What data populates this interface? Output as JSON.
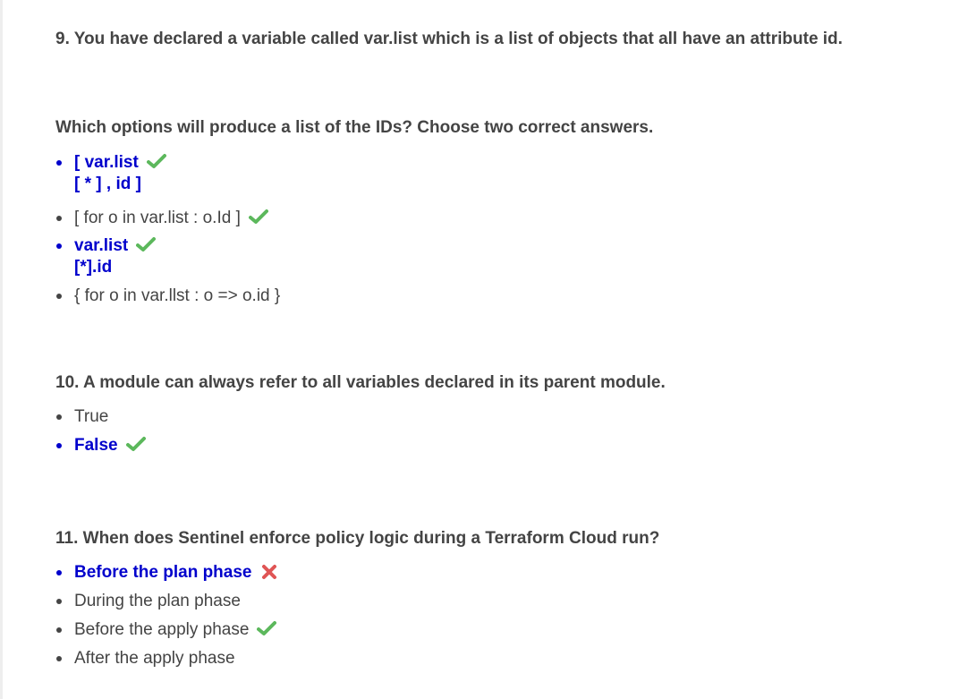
{
  "questions": [
    {
      "title": "9. You have declared a variable called var.list which is a list of objects that all have an attribute id.",
      "subtitle": "Which options will produce a list of the IDs? Choose two correct answers.",
      "options": [
        {
          "line1": "[ var.list",
          "line2": "[ * ] , id ]",
          "selected": true,
          "mark": "check-icon"
        },
        {
          "line1": "[ for o in var.list : o.Id ]",
          "selected": false,
          "mark": "check-icon"
        },
        {
          "line1": "var.list",
          "line2": "[*].id",
          "selected": true,
          "mark": "check-icon"
        },
        {
          "line1": "{ for o in var.llst : o => o.id }",
          "selected": false,
          "mark": "none"
        }
      ]
    },
    {
      "title": "10. A module can always refer to all variables declared in its parent module.",
      "options": [
        {
          "line1": "True",
          "selected": false,
          "mark": "none"
        },
        {
          "line1": "False",
          "selected": true,
          "mark": "check-icon"
        }
      ]
    },
    {
      "title": "11. When does Sentinel enforce policy logic during a Terraform Cloud run?",
      "options": [
        {
          "line1": "Before the plan phase",
          "selected": true,
          "mark": "cross-icon"
        },
        {
          "line1": "During the plan phase",
          "selected": false,
          "mark": "none"
        },
        {
          "line1": "Before the apply phase",
          "selected": false,
          "mark": "check-icon"
        },
        {
          "line1": "After the apply phase",
          "selected": false,
          "mark": "none"
        }
      ]
    }
  ],
  "colors": {
    "selected_text": "#0000cc",
    "body_text": "#444444",
    "check": "#5cb85c",
    "cross": "#e05555"
  }
}
